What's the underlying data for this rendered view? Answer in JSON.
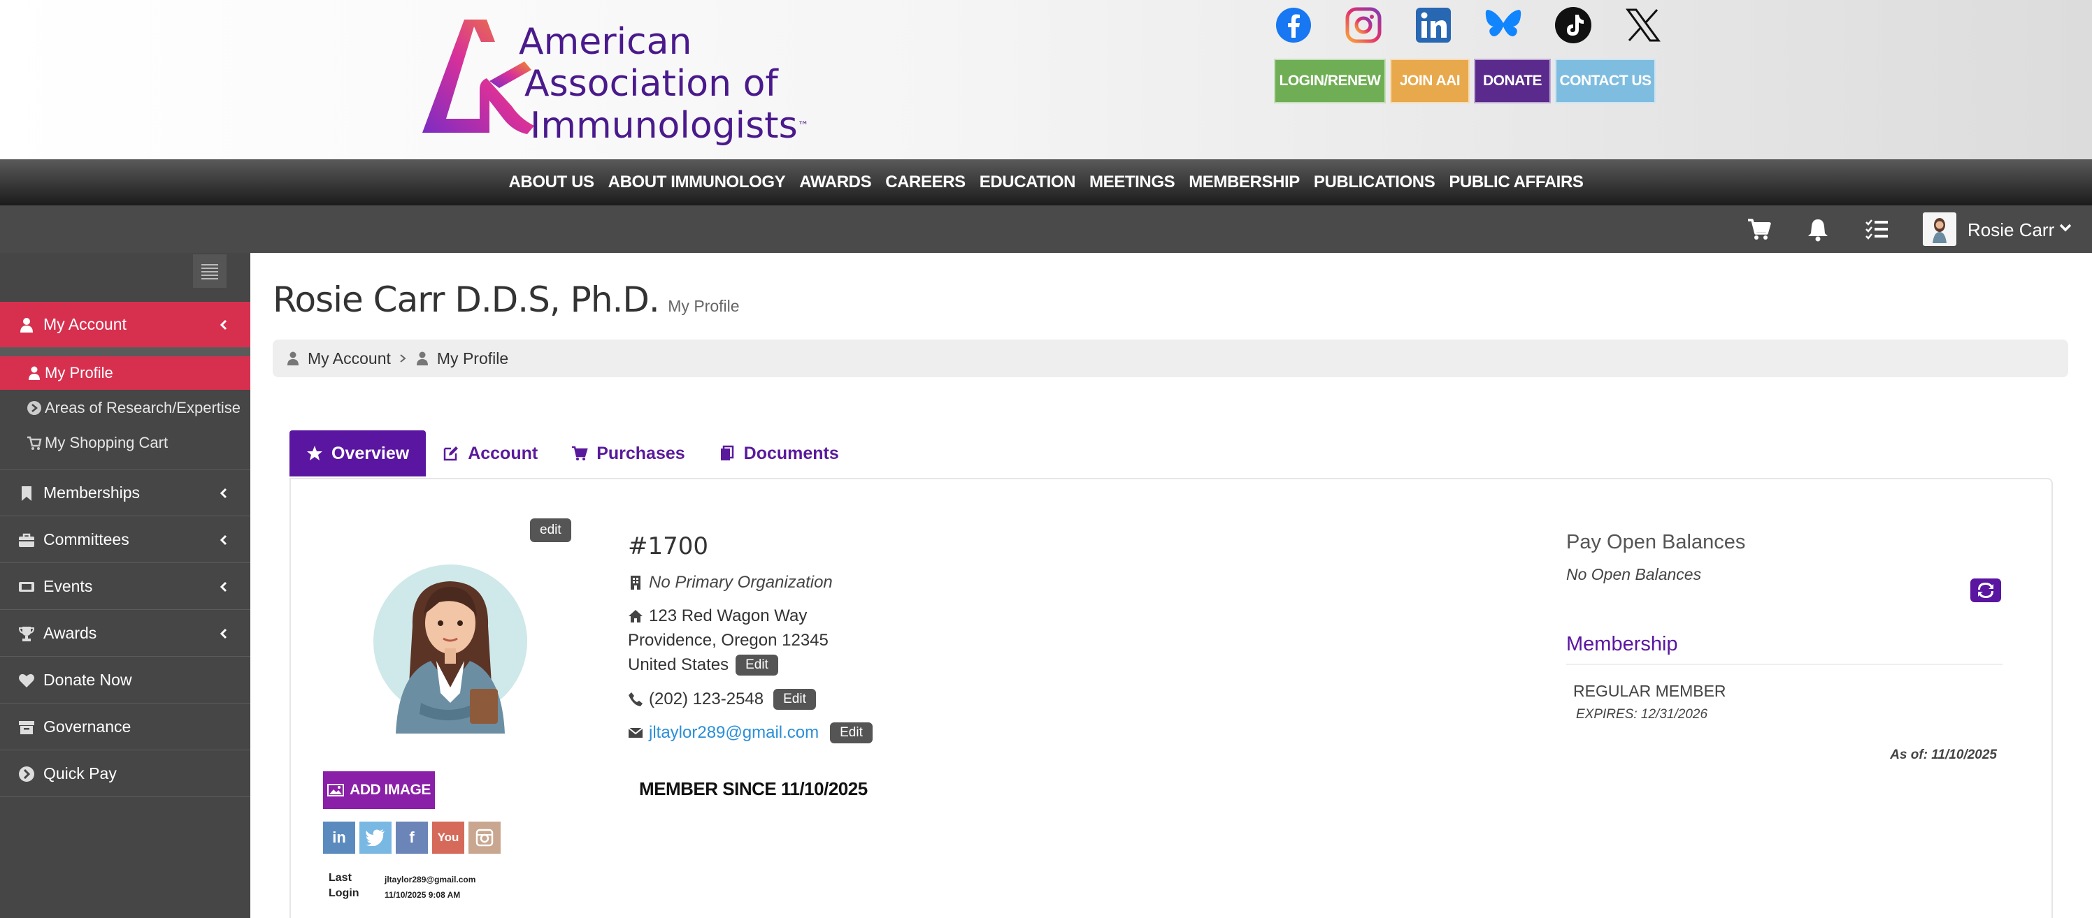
{
  "org": {
    "name_line1": "American",
    "name_line2": "Association of",
    "name_line3": "Immunologists",
    "trademark": "™"
  },
  "social_icons": [
    "facebook-icon",
    "instagram-icon",
    "linkedin-icon",
    "bluesky-icon",
    "tiktok-icon",
    "x-icon"
  ],
  "actions": {
    "login": "LOGIN/RENEW",
    "join": "JOIN AAI",
    "donate": "DONATE",
    "contact": "CONTACT US"
  },
  "main_nav": [
    "ABOUT US",
    "ABOUT IMMUNOLOGY",
    "AWARDS",
    "CAREERS",
    "EDUCATION",
    "MEETINGS",
    "MEMBERSHIP",
    "PUBLICATIONS",
    "PUBLIC AFFAIRS"
  ],
  "user_bar": {
    "user_name": "Rosie Carr",
    "icons": [
      "cart-icon",
      "bell-icon",
      "tasks-icon"
    ]
  },
  "sidebar": {
    "sections": [
      {
        "label": "My Account",
        "icon": "user-icon",
        "active": true
      },
      {
        "label": "Memberships",
        "icon": "bookmark-icon"
      },
      {
        "label": "Committees",
        "icon": "briefcase-icon"
      },
      {
        "label": "Events",
        "icon": "ticket-icon"
      },
      {
        "label": "Awards",
        "icon": "trophy-icon"
      },
      {
        "label": "Donate Now",
        "icon": "heart-icon"
      },
      {
        "label": "Governance",
        "icon": "archive-icon"
      },
      {
        "label": "Quick Pay",
        "icon": "arrow-circle-icon"
      }
    ],
    "sub_items": [
      {
        "label": "My Profile",
        "icon": "user-icon"
      },
      {
        "label": "Areas of Research/Expertise",
        "icon": "arrow-circle-icon"
      },
      {
        "label": "My Shopping Cart",
        "icon": "cart-icon"
      }
    ]
  },
  "page": {
    "title": "Rosie Carr D.D.S, Ph.D.",
    "subtitle": "My Profile",
    "breadcrumb": [
      "My Account",
      "My Profile"
    ]
  },
  "tabs": [
    {
      "label": "Overview",
      "icon": "star-icon"
    },
    {
      "label": "Account",
      "icon": "edit-icon"
    },
    {
      "label": "Purchases",
      "icon": "cart-icon"
    },
    {
      "label": "Documents",
      "icon": "documents-icon"
    }
  ],
  "profile": {
    "edit_label": "edit",
    "add_image_label": "ADD IMAGE",
    "member_number": "#1700",
    "organization": "No Primary Organization",
    "address_line1": "123 Red Wagon Way",
    "address_line2": "Providence, Oregon 12345",
    "address_line3": "United States",
    "phone": "(202) 123-2548",
    "email": "jltaylor289@gmail.com",
    "field_edit_label": "Edit",
    "member_since": "MEMBER SINCE 11/10/2025",
    "last_login_label1": "Last",
    "last_login_label2": "Login",
    "last_login_email": "jltaylor289@gmail.com",
    "last_login_time": "11/10/2025 9:08 AM",
    "mini_social": [
      "linkedin-icon",
      "twitter-icon",
      "facebook-icon",
      "youtube-icon",
      "instagram-icon"
    ]
  },
  "balances": {
    "heading": "Pay Open Balances",
    "status": "No Open Balances"
  },
  "membership": {
    "heading": "Membership",
    "type": "REGULAR MEMBER",
    "expires": "EXPIRES: 12/31/2026",
    "as_of": "As of: 11/10/2025"
  },
  "colors": {
    "brand_purple": "#5a16a0",
    "active_red": "#d7304f",
    "login_green": "#6fae54",
    "join_orange": "#e8a94c",
    "contact_blue": "#7fbde0",
    "link_blue": "#2a8fd8"
  }
}
